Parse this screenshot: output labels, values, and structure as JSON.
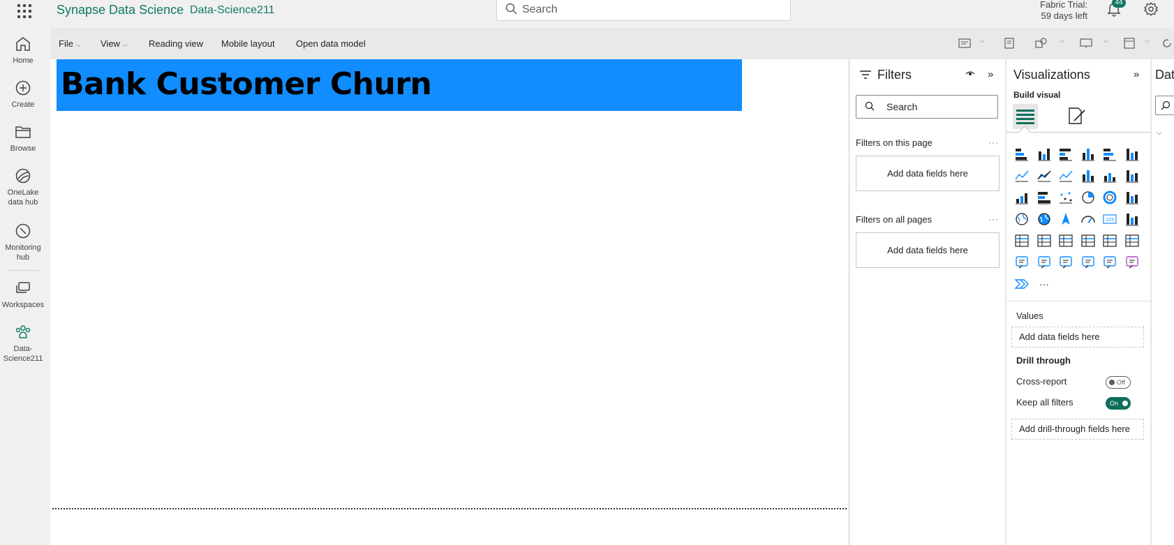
{
  "topbar": {
    "app_name": "Synapse Data Science",
    "workspace": "Data-Science211",
    "search_placeholder": "Search",
    "trial_line1": "Fabric Trial:",
    "trial_line2": "59 days left",
    "notification_count": "44"
  },
  "nav": {
    "home": "Home",
    "create": "Create",
    "browse": "Browse",
    "onelake_1": "OneLake",
    "onelake_2": "data hub",
    "monitoring_1": "Monitoring",
    "monitoring_2": "hub",
    "workspaces": "Workspaces",
    "ws_1": "Data-",
    "ws_2": "Science211"
  },
  "ribbon": {
    "file": "File",
    "view": "View",
    "reading_view": "Reading view",
    "mobile_layout": "Mobile layout",
    "open_data_model": "Open data model"
  },
  "canvas": {
    "title": "Bank Customer Churn"
  },
  "filters": {
    "title": "Filters",
    "search": "Search",
    "on_this_page": "Filters on this page",
    "on_all_pages": "Filters on all pages",
    "add_fields": "Add data fields here",
    "dots": "···"
  },
  "visualizations": {
    "title": "Visualizations",
    "build_visual": "Build visual",
    "values_label": "Values",
    "values_well": "Add data fields here",
    "drill_through": "Drill through",
    "cross_report": "Cross-report",
    "cross_report_state": "Off",
    "keep_all_filters": "Keep all filters",
    "keep_all_filters_state": "On",
    "drill_well": "Add drill-through fields here",
    "more": "···"
  },
  "data_pane": {
    "title": "Data"
  },
  "colors": {
    "brand": "#117865",
    "title_bg": "#118dff",
    "viz_icon_blue": "#118dff",
    "viz_icon_dark": "#252423"
  }
}
